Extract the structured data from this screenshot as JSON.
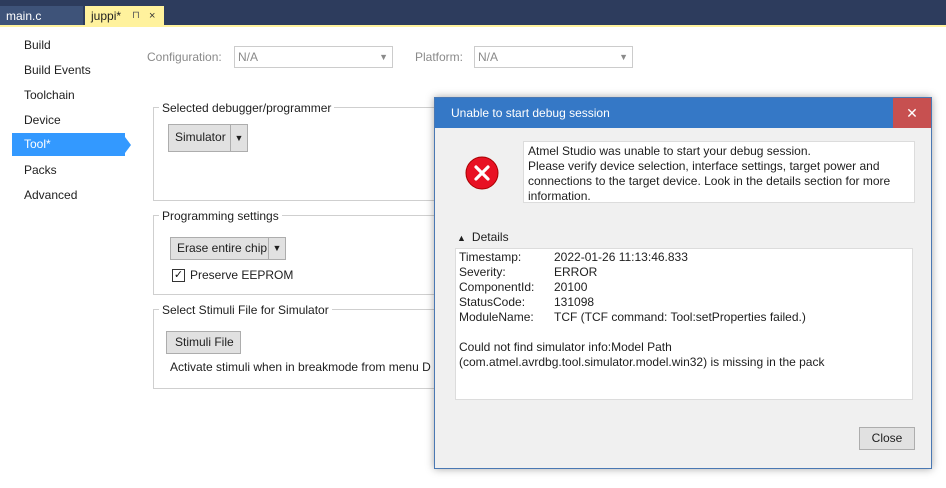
{
  "tabs": [
    {
      "label": "main.c"
    },
    {
      "label": "juppi*",
      "pin_glyph": "⊓",
      "close_glyph": "×"
    }
  ],
  "nav": {
    "items": [
      {
        "label": "Build"
      },
      {
        "label": "Build Events"
      },
      {
        "label": "Toolchain"
      },
      {
        "label": "Device"
      },
      {
        "label": "Tool*",
        "selected": true
      },
      {
        "label": "Packs"
      },
      {
        "label": "Advanced"
      }
    ]
  },
  "config": {
    "configuration_label": "Configuration:",
    "configuration_value": "N/A",
    "platform_label": "Platform:",
    "platform_value": "N/A"
  },
  "debugger": {
    "group_title": "Selected debugger/programmer",
    "value": "Simulator"
  },
  "programming": {
    "group_title": "Programming settings",
    "erase_value": "Erase entire chip",
    "preserve_label": "Preserve EEPROM",
    "preserve_checked": true
  },
  "stimuli": {
    "group_title": "Select Stimuli File for Simulator",
    "button_label": "Stimuli File",
    "description": "Activate stimuli when in breakmode from menu D"
  },
  "dialog": {
    "title": "Unable to start debug session",
    "close_glyph": "✕",
    "message_lines": [
      "Atmel Studio was unable to start your debug session.",
      "Please verify device selection, interface settings, target power and",
      "connections to the target device. Look in the details section for more",
      "information."
    ],
    "details_label": "Details",
    "details": [
      {
        "key": "Timestamp:",
        "value": "2022-01-26 11:13:46.833"
      },
      {
        "key": "Severity:",
        "value": "ERROR"
      },
      {
        "key": "ComponentId:",
        "value": "20100"
      },
      {
        "key": "StatusCode:",
        "value": "131098"
      },
      {
        "key": "ModuleName:",
        "value": "TCF (TCF command: Tool:setProperties failed.)"
      }
    ],
    "extra_lines": [
      "Could not find simulator info:Model Path",
      "(com.atmel.avrdbg.tool.simulator.model.win32) is missing in the pack"
    ],
    "close_button": "Close"
  },
  "colors": {
    "tab_strip": "#2d3c5d",
    "active_tab": "#fff29d",
    "nav_selected": "#3399ff",
    "dialog_title": "#3578c6",
    "dialog_close": "#c75050",
    "error_icon": "#e81123"
  },
  "icons": {
    "error": "error-icon",
    "dropdown": "chevron-down-icon",
    "details_toggle": "chevron-up-icon"
  }
}
